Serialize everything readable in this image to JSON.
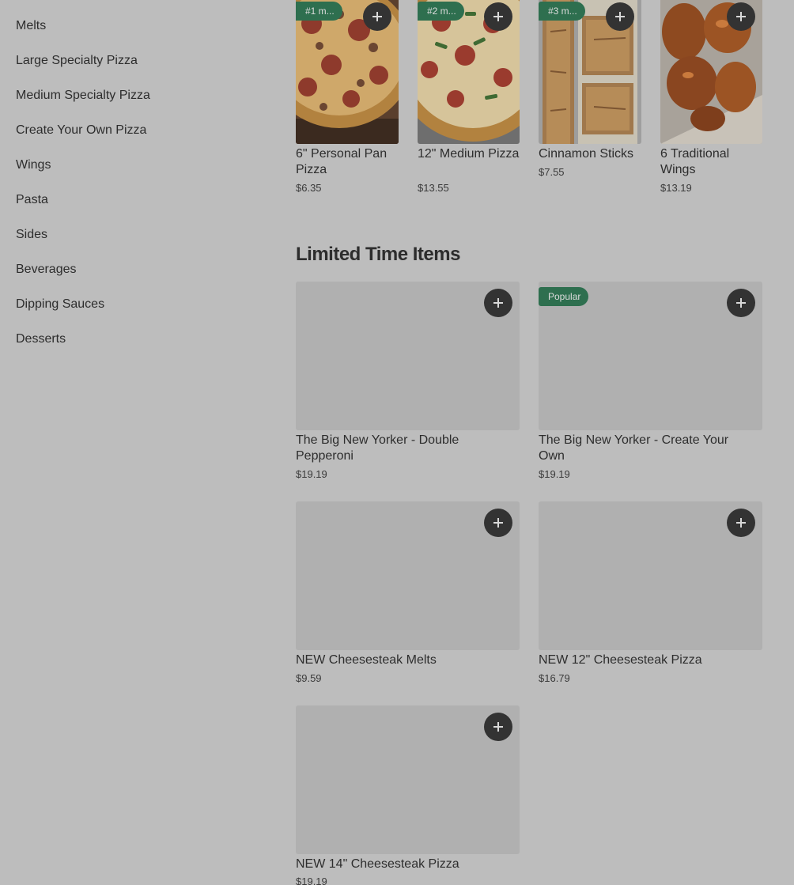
{
  "sidebar": {
    "items": [
      {
        "label": "Melts"
      },
      {
        "label": "Large Specialty Pizza"
      },
      {
        "label": "Medium Specialty Pizza"
      },
      {
        "label": "Create Your Own Pizza"
      },
      {
        "label": "Wings"
      },
      {
        "label": "Pasta"
      },
      {
        "label": "Sides"
      },
      {
        "label": "Beverages"
      },
      {
        "label": "Dipping Sauces"
      },
      {
        "label": "Desserts"
      }
    ]
  },
  "popular": {
    "items": [
      {
        "badge": "#1 m...",
        "title": "6\" Personal Pan Pizza",
        "price": "$6.35",
        "image": "pepperoni-sausage-pizza"
      },
      {
        "badge": "#2 m...",
        "title": "12\" Medium Pizza",
        "price": "$13.55",
        "image": "pepperoni-green-pepper-pizza"
      },
      {
        "badge": "#3 m...",
        "title": "Cinnamon Sticks",
        "price": "$7.55",
        "image": "cinnamon-sticks"
      },
      {
        "badge": "",
        "title": "6 Traditional Wings",
        "price": "$13.19",
        "image": "buffalo-wings"
      }
    ]
  },
  "limited": {
    "title": "Limited Time Items",
    "items": [
      {
        "badge": "",
        "title": "The Big New Yorker - Double Pepperoni",
        "price": "$19.19"
      },
      {
        "badge": "Popular",
        "title": "The Big New Yorker - Create Your Own",
        "price": "$19.19"
      },
      {
        "badge": "",
        "title": "NEW Cheesesteak Melts",
        "price": "$9.59"
      },
      {
        "badge": "",
        "title": "NEW 12\" Cheesesteak Pizza",
        "price": "$16.79"
      },
      {
        "badge": "",
        "title": "NEW 14\" Cheesesteak Pizza",
        "price": "$19.19"
      }
    ]
  },
  "icons": {
    "add": "plus-icon"
  },
  "colors": {
    "badge": "#2e6f4f",
    "add_button": "#333333",
    "background": "#bdbdbd"
  }
}
